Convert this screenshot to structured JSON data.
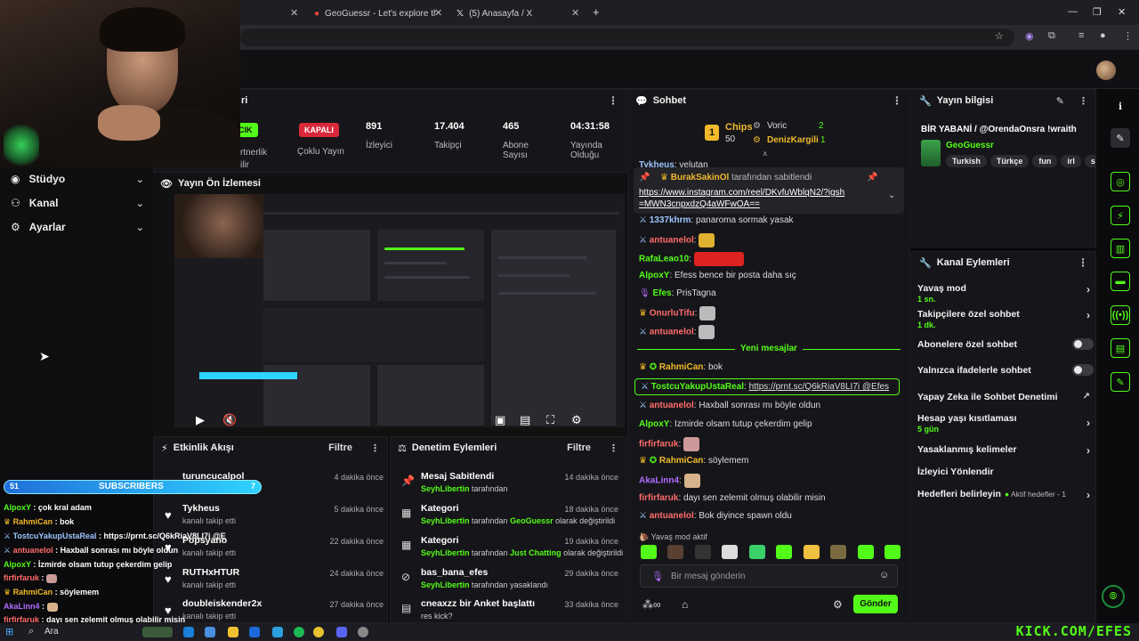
{
  "browser": {
    "tabs": [
      {
        "label": "GeoGuessr - Let's explore the world!",
        "icon": "map-pin-icon"
      },
      {
        "label": "(5) Anasayfa / X",
        "icon": "x-logo-icon"
      }
    ]
  },
  "nav": [
    {
      "label": "Stüdyo",
      "icon": "video-icon"
    },
    {
      "label": "Kanal",
      "icon": "users-icon"
    },
    {
      "label": "Ayarlar",
      "icon": "gear-icon"
    }
  ],
  "stream_stats": {
    "panel_title_fragment": "ri",
    "status_badge": "CIK",
    "status_label_line1": "rtnerlik",
    "status_label_line2": "ilir",
    "multistream_badge": "KAPALI",
    "multistream_label": "Çoklu Yayın",
    "viewers_value": "891",
    "viewers_label": "İzleyici",
    "followers_value": "17.404",
    "followers_label": "Takipçi",
    "subs_value": "465",
    "subs_label": "Abone Sayısı",
    "uptime_value": "04:31:58",
    "uptime_label": "Yayında Olduğu"
  },
  "preview": {
    "title": "Yayın Ön İzlemesi"
  },
  "activity": {
    "title": "Etkinlik Akışı",
    "filter": "Filtre",
    "items": [
      {
        "user": "turuncucalpol",
        "desc": "",
        "time": "4 dakika önce"
      },
      {
        "user": "Tykheus",
        "desc": "kanalı takip etti",
        "time": "5 dakika önce"
      },
      {
        "user": "Popsyano",
        "desc": "kanalı takip etti",
        "time": "22 dakika önce"
      },
      {
        "user": "RUTHxHTUR",
        "desc": "kanalı takip etti",
        "time": "24 dakika önce"
      },
      {
        "user": "doubleiskender2x",
        "desc": "kanalı takip etti",
        "time": "27 dakika önce"
      }
    ]
  },
  "moderation": {
    "title": "Denetim Eylemleri",
    "filter": "Filtre",
    "items": [
      {
        "icon": "pin-icon",
        "title": "Mesaj Sabitlendi",
        "actor": "SeyhLibertin",
        "text": "tarafından",
        "extra": "",
        "tail": "",
        "time": "14 dakika önce"
      },
      {
        "icon": "category-icon",
        "title": "Kategori",
        "actor": "SeyhLibertin",
        "text": "tarafından",
        "extra": "GeoGuessr",
        "tail": "olarak değiştirildi",
        "time": "18 dakika önce"
      },
      {
        "icon": "category-icon",
        "title": "Kategori",
        "actor": "SeyhLibertin",
        "text": "tarafından",
        "extra": "Just Chatting",
        "tail": "olarak değiştirildi",
        "time": "19 dakika önce"
      },
      {
        "icon": "ban-icon",
        "title": "bas_bana_efes",
        "actor": "SeyhLibertin",
        "text": "tarafından yasaklandı",
        "extra": "",
        "tail": "",
        "time": "29 dakika önce"
      },
      {
        "icon": "poll-icon",
        "title": "cneaxzz bir Anket başlattı",
        "actor": "",
        "text": "res kick?",
        "extra": "",
        "tail": "",
        "time": "33 dakika önce"
      }
    ]
  },
  "chat": {
    "title": "Sohbet",
    "chips_label": "Chips",
    "chips_rank": "1",
    "chips_value": "50",
    "top2_name": "Voric",
    "top2_value": "2",
    "top3_name": "DenizKargili",
    "top3_value": "1",
    "cut_line_user": "Tykheus",
    "cut_line_text": "velutan",
    "pinned_by": "BurakSakinOl",
    "pinned_by_suffix": "tarafından sabitlendi",
    "pinned_link": "https://www.instagram.com/reel/DKvfuWblqN2/?igsh=MWN3cnpxdzQ4aWFwOA==",
    "new_messages_label": "Yeni mesajlar",
    "messages": [
      {
        "user": "1337khrm",
        "color": "#9ec5ff",
        "text": "panaroma sormak yasak",
        "emote": false
      },
      {
        "user": "antuanelol",
        "color": "#ff6b6b",
        "text": "",
        "emote": true
      },
      {
        "user": "RafaLeao10",
        "color": "#53fc18",
        "text": "",
        "emote": true
      },
      {
        "user": "AlpoxY",
        "color": "#53fc18",
        "text": "Efess bence bir posta daha sıç",
        "emote": false
      },
      {
        "user": "Efes",
        "color": "#53fc18",
        "text": "PrisTagna",
        "emote": false
      },
      {
        "user": "OnurluTifu",
        "color": "#ff6b6b",
        "text": "",
        "emote": true
      },
      {
        "user": "antuanelol",
        "color": "#ff6b6b",
        "text": "",
        "emote": true
      },
      {
        "user": "RahmiCan",
        "color": "#f0b92a",
        "text": "bok",
        "emote": false
      },
      {
        "user": "TostcuYakupUstaReal",
        "color": "#53fc18",
        "text": "https://prnt.sc/Q6kRiaV8LI7i @Efes",
        "emote": false
      },
      {
        "user": "antuanelol",
        "color": "#ff6b6b",
        "text": "Haxball sonrası mı böyle oldun",
        "emote": false
      },
      {
        "user": "AlpoxY",
        "color": "#53fc18",
        "text": "İzmirde olsam tutup çekerdim gelip",
        "emote": false
      },
      {
        "user": "firfirfaruk",
        "color": "#ff6b6b",
        "text": "",
        "emote": true
      },
      {
        "user": "RahmiCan",
        "color": "#f0b92a",
        "text": "söylemem",
        "emote": false
      },
      {
        "user": "AkaLinn4",
        "color": "#b06bff",
        "text": "",
        "emote": true
      },
      {
        "user": "firfirfaruk",
        "color": "#ff6b6b",
        "text": "dayı sen zelemit olmuş olabilir misin",
        "emote": false
      },
      {
        "user": "antuanelol",
        "color": "#ff6b6b",
        "text": "Bok diyince spawn oldu",
        "emote": false
      }
    ],
    "slow_mode_notice": "Yavaş mod aktif",
    "input_placeholder": "Bir mesaj gönderin",
    "send_label": "Gönder"
  },
  "stream_info": {
    "title": "Yayın bilgisi",
    "stream_title": "BİR YABANİ / @OrendaOnsra !wraith",
    "category": "GeoGuessr",
    "tags": [
      "Turkish",
      "Türkçe",
      "fun",
      "irl",
      "spe"
    ]
  },
  "channel_actions": {
    "title": "Kanal Eylemleri",
    "items": [
      {
        "label": "Yavaş mod",
        "sub": "1 sn.",
        "control": "arrow"
      },
      {
        "label": "Takipçilere özel sohbet",
        "sub": "1 dk.",
        "control": "arrow"
      },
      {
        "label": "Abonelere özel sohbet",
        "sub": "",
        "control": "toggle"
      },
      {
        "label": "Yalnızca ifadelerle sohbet",
        "sub": "",
        "control": "toggle"
      },
      {
        "label": "Yapay Zeka ile Sohbet Denetimi",
        "sub": "",
        "control": "external"
      },
      {
        "label": "Hesap yaşı kısıtlaması",
        "sub": "5 gün",
        "control": "arrow"
      },
      {
        "label": "Yasaklanmış kelimeler",
        "sub": "",
        "control": "arrow"
      },
      {
        "label": "İzleyici Yönlendir",
        "sub": "",
        "control": "none"
      },
      {
        "label": "Hedefleri belirleyin",
        "sub": "",
        "control": "goal",
        "goal_text": "Aktif hedefler - 1"
      }
    ]
  },
  "overlay": {
    "sub_goal_current": "51",
    "sub_goal_label": "SUBSCRIBERS",
    "sub_goal_target": "7",
    "lines": [
      {
        "user": "AlpoxY",
        "color": "#53fc18",
        "text": "çok kral adam"
      },
      {
        "user": "RahmiCan",
        "color": "#f0b92a",
        "text": "bok"
      },
      {
        "user": "TostcuYakupUstaReal",
        "color": "#9ec5ff",
        "text": "https://prnt.sc/Q6kRiaV8LI7i @Efes"
      },
      {
        "user": "antuanelol",
        "color": "#ff6b6b",
        "text": "Haxball sonrası mı böyle oldun"
      },
      {
        "user": "AlpoxY",
        "color": "#53fc18",
        "text": "İzmirde olsam tutup çekerdim gelip"
      },
      {
        "user": "firfirfaruk",
        "color": "#ff6b6b",
        "text": ""
      },
      {
        "user": "RahmiCan",
        "color": "#f0b92a",
        "text": "söylemem"
      },
      {
        "user": "AkaLinn4",
        "color": "#b06bff",
        "text": ""
      },
      {
        "user": "firfirfaruk",
        "color": "#ff6b6b",
        "text": "dayı sen zelemit olmuş olabilir misin"
      }
    ]
  },
  "taskbar": {
    "search": "Ara"
  },
  "watermark": "KICK.COM/EFES"
}
